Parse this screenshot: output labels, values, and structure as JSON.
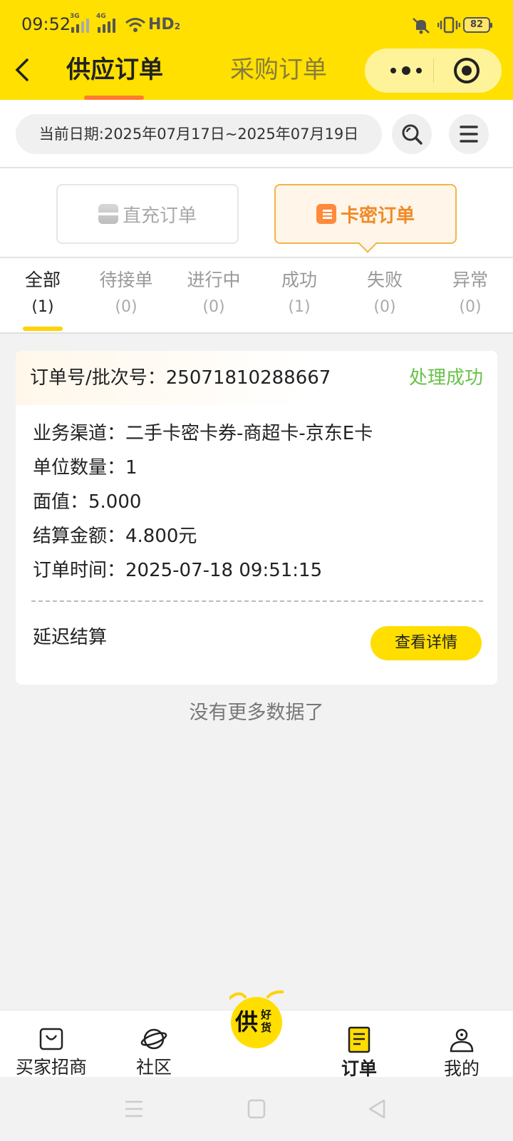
{
  "status_bar": {
    "time": "09:52",
    "net1": "3G",
    "net2": "4G",
    "hd": "HD",
    "hd_sub": "2",
    "battery": "82"
  },
  "header": {
    "tab_supply": "供应订单",
    "tab_purchase": "采购订单",
    "accent_color": "#ffe000"
  },
  "filter": {
    "date_range": "当前日期:2025年07月17日~2025年07月19日"
  },
  "order_type": {
    "direct": "直充订单",
    "card": "卡密订单"
  },
  "status_tabs": [
    {
      "label": "全部",
      "count": "(1)"
    },
    {
      "label": "待接单",
      "count": "(0)"
    },
    {
      "label": "进行中",
      "count": "(0)"
    },
    {
      "label": "成功",
      "count": "(1)"
    },
    {
      "label": "失败",
      "count": "(0)"
    },
    {
      "label": "异常",
      "count": "(0)"
    }
  ],
  "order": {
    "number_line": "订单号/批次号：25071810288667",
    "status": "处理成功",
    "rows": [
      "业务渠道：二手卡密卡券-商超卡-京东E卡",
      "单位数量：1",
      "面值：5.000",
      "结算金额：4.800元",
      "订单时间：2025-07-18 09:51:15"
    ],
    "settlement": "延迟结算",
    "detail_button": "查看详情"
  },
  "no_more": "没有更多数据了",
  "tabbar": {
    "items": [
      {
        "label": "买家招商",
        "icon": "shopping-bag-icon"
      },
      {
        "label": "社区",
        "icon": "planet-icon"
      },
      {
        "label": "订单",
        "icon": "order-list-icon"
      },
      {
        "label": "我的",
        "icon": "user-icon"
      }
    ],
    "center_logo_text": "供",
    "center_logo_sub1": "好",
    "center_logo_sub2": "货"
  }
}
